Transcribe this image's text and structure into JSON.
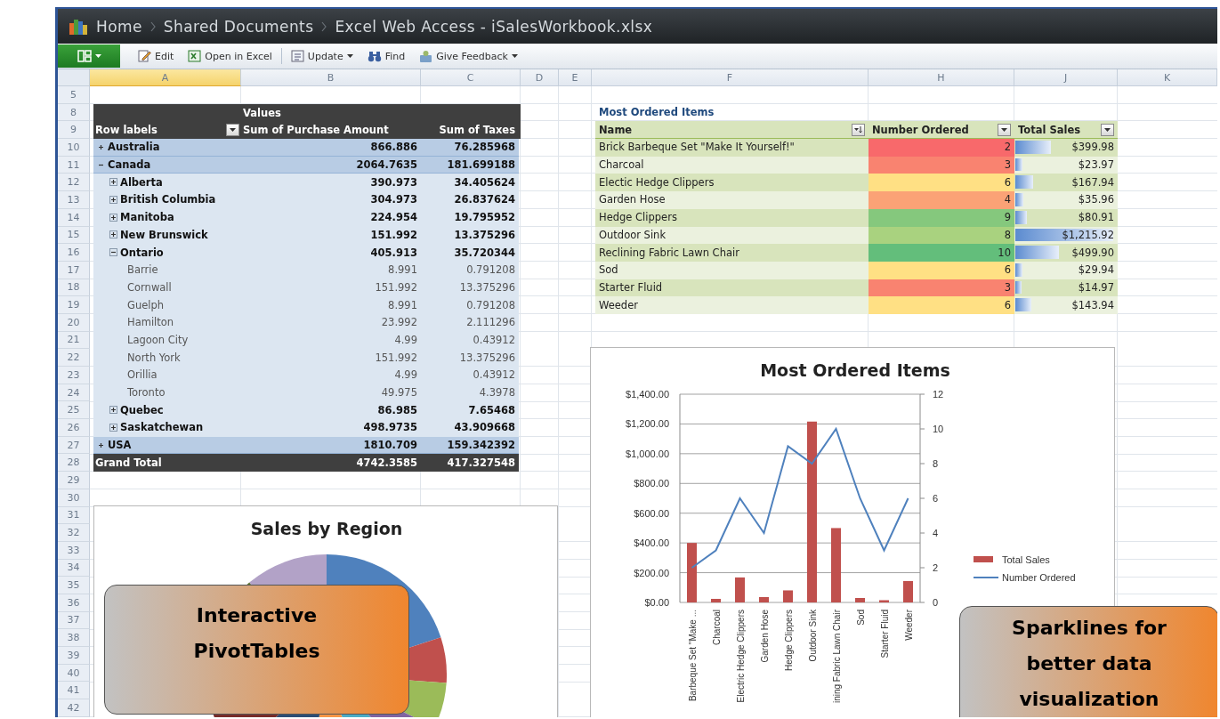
{
  "window": {
    "breadcrumb": [
      "Home",
      "Shared Documents",
      "Excel Web Access - iSalesWorkbook.xlsx"
    ]
  },
  "toolbar": [
    {
      "kind": "app",
      "has_menu": true
    },
    {
      "kind": "edit",
      "label": "Edit",
      "has_menu": false
    },
    {
      "kind": "open",
      "label": "Open in Excel",
      "has_menu": false
    },
    {
      "kind": "update",
      "label": "Update",
      "has_menu": true
    },
    {
      "kind": "find",
      "label": "Find",
      "has_menu": false
    },
    {
      "kind": "feedback",
      "label": "Give Feedback",
      "has_menu": true
    }
  ],
  "column_headers": [
    {
      "label": "A",
      "selected": true
    },
    {
      "label": "B",
      "selected": false
    },
    {
      "label": "C",
      "selected": false
    },
    {
      "label": "D",
      "selected": false
    },
    {
      "label": "E",
      "selected": false
    },
    {
      "label": "F",
      "selected": false
    },
    {
      "label": "H",
      "selected": false
    },
    {
      "label": "J",
      "selected": false
    },
    {
      "label": "K",
      "selected": false
    }
  ],
  "row_numbers": [
    "5",
    "8",
    "9",
    "10",
    "11",
    "12",
    "13",
    "14",
    "15",
    "16",
    "17",
    "18",
    "19",
    "20",
    "21",
    "22",
    "23",
    "24",
    "25",
    "26",
    "27",
    "28",
    "29",
    "30",
    "31",
    "32",
    "33",
    "34",
    "35",
    "36",
    "37",
    "38",
    "39",
    "40",
    "41",
    "42"
  ],
  "pivot": {
    "values_caption": "Values",
    "columns": [
      "Row labels",
      "Sum of Purchase Amount",
      "Sum of Taxes"
    ],
    "rows": [
      {
        "label": "Australia",
        "amount": "866.886",
        "taxes": "76.285968",
        "expanded": false
      },
      {
        "label": "Canada",
        "amount": "2064.7635",
        "taxes": "181.699188",
        "expanded": true,
        "children": [
          {
            "label": "Alberta",
            "amount": "390.973",
            "taxes": "34.405624",
            "expanded": false
          },
          {
            "label": "British Columbia",
            "amount": "304.973",
            "taxes": "26.837624",
            "expanded": false
          },
          {
            "label": "Manitoba",
            "amount": "224.954",
            "taxes": "19.795952",
            "expanded": false
          },
          {
            "label": "New Brunswick",
            "amount": "151.992",
            "taxes": "13.375296",
            "expanded": false
          },
          {
            "label": "Ontario",
            "amount": "405.913",
            "taxes": "35.720344",
            "expanded": true,
            "children": [
              {
                "label": "Barrie",
                "amount": "8.991",
                "taxes": "0.791208"
              },
              {
                "label": "Cornwall",
                "amount": "151.992",
                "taxes": "13.375296"
              },
              {
                "label": "Guelph",
                "amount": "8.991",
                "taxes": "0.791208"
              },
              {
                "label": "Hamilton",
                "amount": "23.992",
                "taxes": "2.111296"
              },
              {
                "label": "Lagoon City",
                "amount": "4.99",
                "taxes": "0.43912"
              },
              {
                "label": "North York",
                "amount": "151.992",
                "taxes": "13.375296"
              },
              {
                "label": "Orillia",
                "amount": "4.99",
                "taxes": "0.43912"
              },
              {
                "label": "Toronto",
                "amount": "49.975",
                "taxes": "4.3978"
              }
            ]
          },
          {
            "label": "Quebec",
            "amount": "86.985",
            "taxes": "7.65468",
            "expanded": false
          },
          {
            "label": "Saskatchewan",
            "amount": "498.9735",
            "taxes": "43.909668",
            "expanded": false
          }
        ]
      },
      {
        "label": "USA",
        "amount": "1810.709",
        "taxes": "159.342392",
        "expanded": false
      }
    ],
    "grand_total": {
      "label": "Grand Total",
      "amount": "4742.3585",
      "taxes": "417.327548"
    }
  },
  "most_ordered": {
    "title": "Most Ordered Items",
    "columns": [
      {
        "label": "Name",
        "kind": "sorted"
      },
      {
        "label": "Number Ordered",
        "kind": "dropdown"
      },
      {
        "label": "Total Sales",
        "kind": "dropdown"
      }
    ],
    "items": [
      {
        "name": "Brick Barbeque Set \"Make It Yourself!\"",
        "ordered": "2",
        "color": "#f8696b",
        "sales": "$399.98",
        "level": 0.33
      },
      {
        "name": "Charcoal",
        "ordered": "3",
        "color": "#f98370",
        "sales": "$23.97",
        "level": 0.02
      },
      {
        "name": "Electic Hedge Clippers",
        "ordered": "6",
        "color": "#ffe084",
        "sales": "$167.94",
        "level": 0.14
      },
      {
        "name": "Garden Hose",
        "ordered": "4",
        "color": "#fba276",
        "sales": "$35.96",
        "level": 0.03
      },
      {
        "name": "Hedge Clippers",
        "ordered": "9",
        "color": "#85c87d",
        "sales": "$80.91",
        "level": 0.07
      },
      {
        "name": "Outdoor Sink",
        "ordered": "8",
        "color": "#a9d27f",
        "sales": "$1,215.92",
        "level": 1
      },
      {
        "name": "Reclining Fabric Lawn Chair",
        "ordered": "10",
        "color": "#63be7b",
        "sales": "$499.90",
        "level": 0.41
      },
      {
        "name": "Sod",
        "ordered": "6",
        "color": "#ffe084",
        "sales": "$29.94",
        "level": 0.02
      },
      {
        "name": "Starter Fluid",
        "ordered": "3",
        "color": "#f98370",
        "sales": "$14.97",
        "level": 0.01
      },
      {
        "name": "Weeder",
        "ordered": "6",
        "color": "#ffe084",
        "sales": "$143.94",
        "level": 0.12
      }
    ]
  },
  "sales_chart": {
    "chart_data": {
      "type": "bar",
      "title": "Most Ordered Items",
      "grid": true,
      "legend": "right",
      "categories": [
        "Barbeque Set \"Make ...",
        "Charcoal",
        "Electric Hedge Clippers",
        "Garden Hose",
        "Hedge Clippers",
        "Outdoor Sink",
        "ining Fabric Lawn Chair",
        "Sod",
        "Starter Fluid",
        "Weeder"
      ],
      "series": [
        {
          "name": "Total Sales",
          "color": "#c0504d",
          "values": [
            400,
            24,
            168,
            36,
            81,
            1216,
            500,
            30,
            15,
            144
          ]
        },
        {
          "name": "Number Ordered",
          "type": "line",
          "axis": "y2",
          "color": "#4f81bd",
          "values": [
            2,
            3,
            6,
            4,
            9,
            8,
            10,
            6,
            3,
            6
          ]
        }
      ],
      "ylim": [
        0,
        1400
      ],
      "yticks": [
        {
          "value": 0,
          "label": "$0.00"
        },
        {
          "value": 200,
          "label": "$200.00"
        },
        {
          "value": 400,
          "label": "$400.00"
        },
        {
          "value": 600,
          "label": "$600.00"
        },
        {
          "value": 800,
          "label": "$800.00"
        },
        {
          "value": 1000,
          "label": "$1,000.00"
        },
        {
          "value": 1200,
          "label": "$1,200.00"
        },
        {
          "value": 1400,
          "label": "$1,400.00"
        }
      ],
      "y2lim": [
        0,
        12
      ],
      "y2ticks": [
        0,
        2,
        4,
        6,
        8,
        10,
        12
      ]
    }
  },
  "region_chart": {
    "title": "Sales by Region"
  },
  "callouts": [
    {
      "text": "Interactive PivotTables"
    },
    {
      "text": "Sparklines for better data visualization"
    }
  ]
}
